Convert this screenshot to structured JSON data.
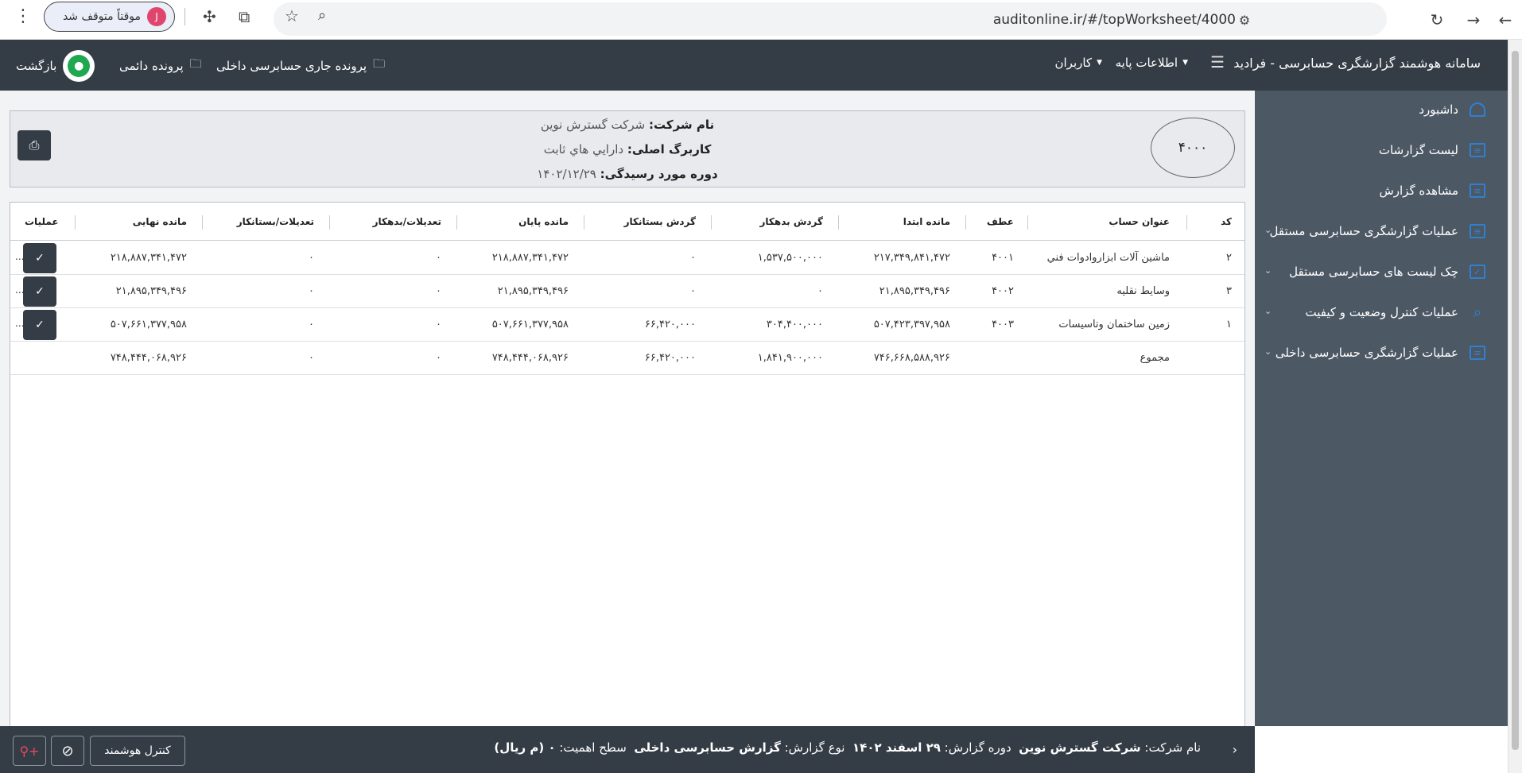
{
  "browser": {
    "url": "auditonline.ir/#/topWorksheet/4000",
    "profile_label": "موقتاً متوقف شد",
    "profile_initial": "J"
  },
  "header": {
    "brand": "سامانه هوشمند گزارشگری حسابرسی - فرادید",
    "menu_base": "اطلاعات پایه",
    "menu_users": "کاربران",
    "file_current": "پرونده جاری حسابرسی داخلی",
    "file_permanent": "پرونده دائمی",
    "back_label": "بازگشت"
  },
  "sidebar": {
    "items": [
      {
        "label": "داشبورد",
        "icon": "dashboard-icon"
      },
      {
        "label": "لیست گزارشات",
        "icon": "list-icon"
      },
      {
        "label": "مشاهده گزارش",
        "icon": "report-icon"
      },
      {
        "label": "عملیات گزارشگری حسابرسی مستقل",
        "icon": "document-icon"
      },
      {
        "label": "چک لیست های حسابرسی مستقل",
        "icon": "checklist-icon"
      },
      {
        "label": "عملیات کنترل وضعیت و کیفیت",
        "icon": "search-icon"
      },
      {
        "label": "عملیات گزارشگری حسابرسی داخلی",
        "icon": "document-icon"
      }
    ]
  },
  "info": {
    "code": "۴۰۰۰",
    "company_label": "نام شرکت:",
    "company_value": "شرکت گسترش نوین",
    "sheet_label": "کاربرگ اصلی:",
    "sheet_value": "دارايي هاي ثابت",
    "period_label": "دوره مورد رسیدگی:",
    "period_value": "۱۴۰۲/۱۲/۲۹"
  },
  "table": {
    "columns": [
      "کد",
      "عنوان حساب",
      "عطف",
      "مانده ابتدا",
      "گردش بدهکار",
      "گردش بستانکار",
      "مانده پایان",
      "تعدیلات/بدهکار",
      "تعدیلات/بستانکار",
      "مانده نهایی",
      "عملیات"
    ],
    "rows": [
      {
        "code": "۲",
        "title": "ماشین آلات ابزاروادوات فني",
        "ref": "۴۰۰۱",
        "opening": "۲۱۷,۳۴۹,۸۴۱,۴۷۲",
        "debit": "۱,۵۳۷,۵۰۰,۰۰۰",
        "credit": "۰",
        "closing": "۲۱۸,۸۸۷,۳۴۱,۴۷۲",
        "adj_debit": "۰",
        "adj_credit": "۰",
        "final": "۲۱۸,۸۸۷,۳۴۱,۴۷۲"
      },
      {
        "code": "۳",
        "title": "وسايط نقليه",
        "ref": "۴۰۰۲",
        "opening": "۲۱,۸۹۵,۳۴۹,۴۹۶",
        "debit": "۰",
        "credit": "۰",
        "closing": "۲۱,۸۹۵,۳۴۹,۴۹۶",
        "adj_debit": "۰",
        "adj_credit": "۰",
        "final": "۲۱,۸۹۵,۳۴۹,۴۹۶"
      },
      {
        "code": "۱",
        "title": "زمين ساختمان وتاسيسات",
        "ref": "۴۰۰۳",
        "opening": "۵۰۷,۴۲۳,۳۹۷,۹۵۸",
        "debit": "۳۰۴,۴۰۰,۰۰۰",
        "credit": "۶۶,۴۲۰,۰۰۰",
        "closing": "۵۰۷,۶۶۱,۳۷۷,۹۵۸",
        "adj_debit": "۰",
        "adj_credit": "۰",
        "final": "۵۰۷,۶۶۱,۳۷۷,۹۵۸"
      }
    ],
    "total": {
      "title": "مجموع",
      "opening": "۷۴۶,۶۶۸,۵۸۸,۹۲۶",
      "debit": "۱,۸۴۱,۹۰۰,۰۰۰",
      "credit": "۶۶,۴۲۰,۰۰۰",
      "closing": "۷۴۸,۴۴۴,۰۶۸,۹۲۶",
      "adj_debit": "۰",
      "adj_credit": "۰",
      "final": "۷۴۸,۴۴۴,۰۶۸,۹۲۶"
    },
    "more": "..."
  },
  "footer": {
    "company_label": "نام شرکت:",
    "company_value": "شرکت گسترش نوین",
    "period_label": "دوره گزارش:",
    "period_value": "۲۹ اسفند ۱۴۰۲",
    "type_label": "نوع گزارش:",
    "type_value": "گزارش حسابرسی داخلی",
    "materiality_label": "سطح اهمیت:",
    "materiality_value": "۰ (م ریال)",
    "smart_control": "کنترل هوشمند"
  },
  "colors": {
    "header_bg": "#343c45",
    "sidebar_bg": "#4d5865",
    "accent": "#2f80d0",
    "avatar_green": "#1fa84f"
  }
}
